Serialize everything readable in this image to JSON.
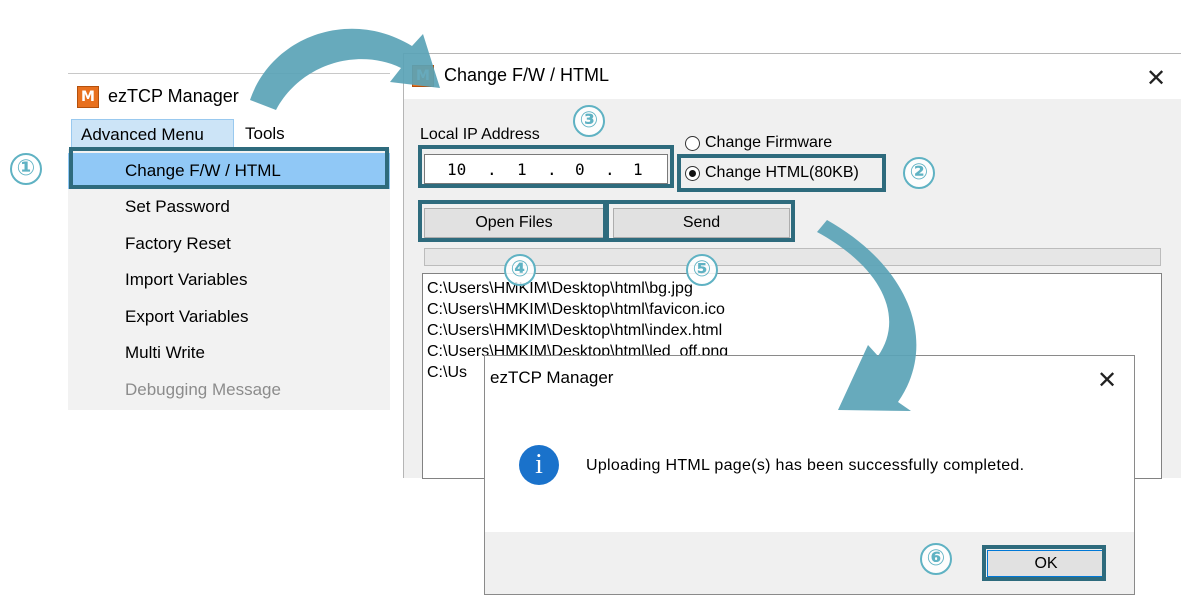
{
  "menu_window": {
    "title": "ezTCP Manager",
    "logo_letter": "M",
    "menubar": [
      "Advanced Menu",
      "Tools"
    ],
    "dropdown_items": [
      {
        "label": "Change F/W / HTML",
        "state": "highlighted"
      },
      {
        "label": "Set Password",
        "state": "normal"
      },
      {
        "label": "Factory Reset",
        "state": "normal"
      },
      {
        "label": "Import Variables",
        "state": "normal"
      },
      {
        "label": "Export Variables",
        "state": "normal"
      },
      {
        "label": "Multi Write",
        "state": "normal"
      },
      {
        "label": "Debugging Message",
        "state": "disabled"
      }
    ]
  },
  "fw_window": {
    "title": "Change F/W / HTML",
    "logo_letter": "M",
    "close_glyph": "✕",
    "local_ip_label": "Local IP Address",
    "ip": [
      "10",
      "1",
      "0",
      "1"
    ],
    "ip_dot": ".",
    "radio_firmware": "Change Firmware",
    "radio_html": "Change HTML(80KB)",
    "open_files_label": "Open Files",
    "send_label": "Send",
    "files": [
      "C:\\Users\\HMKIM\\Desktop\\html\\bg.jpg",
      "C:\\Users\\HMKIM\\Desktop\\html\\favicon.ico",
      "C:\\Users\\HMKIM\\Desktop\\html\\index.html",
      "C:\\Users\\HMKIM\\Desktop\\html\\led_off.png",
      "C:\\Us"
    ]
  },
  "msg_dialog": {
    "title": "ezTCP Manager",
    "close_glyph": "✕",
    "icon_glyph": "i",
    "message": "Uploading HTML page(s) has been successfully completed.",
    "ok_label": "OK"
  },
  "steps": [
    "①",
    "②",
    "③",
    "④",
    "⑤",
    "⑥"
  ],
  "colors": {
    "highlight_border": "#2e6b7d",
    "step_number": "#5fb2c3",
    "arrow": "#5aa3b6",
    "menu_highlight": "#90c8f6"
  }
}
